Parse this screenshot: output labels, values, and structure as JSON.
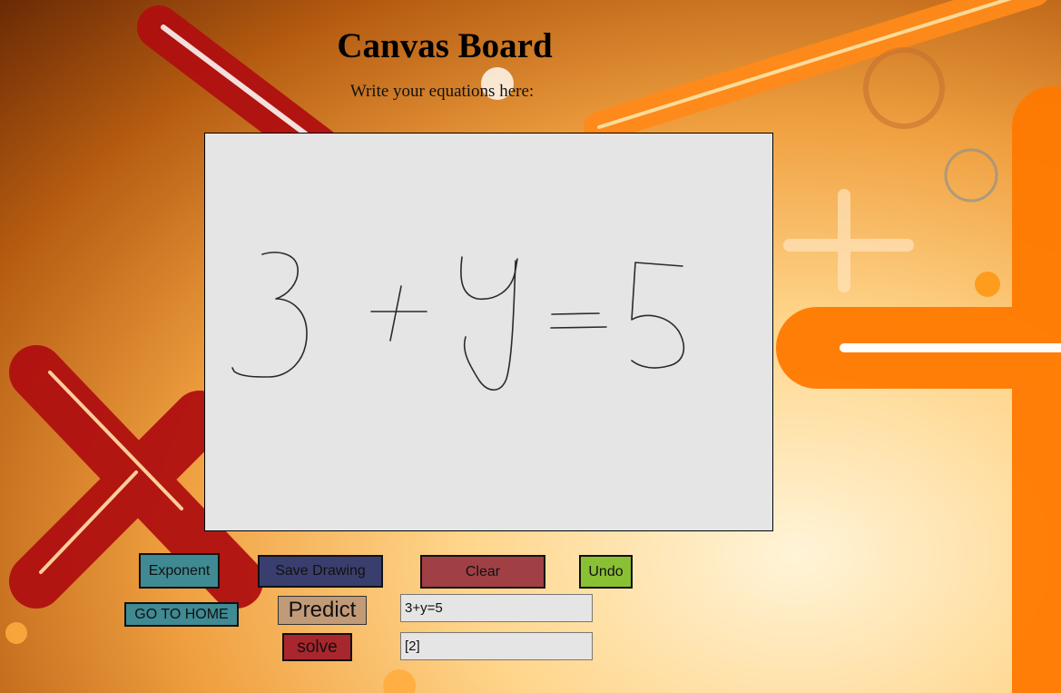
{
  "page": {
    "title": "Canvas Board",
    "subtitle": "Write your equations here:"
  },
  "buttons": {
    "exponent": "Exponent",
    "save": "Save Drawing",
    "clear": "Clear",
    "undo": "Undo",
    "home": "GO TO HOME",
    "predict": "Predict",
    "solve": "solve"
  },
  "fields": {
    "prediction": "3+y=5",
    "solution": "[2]"
  },
  "colors": {
    "exponent": "#3f8a93",
    "save": "#3a3e6e",
    "clear": "#a04045",
    "undo": "#8ac034",
    "predict": "#c19a78",
    "solve": "#a8262e",
    "canvas": "#e5e5e5"
  }
}
